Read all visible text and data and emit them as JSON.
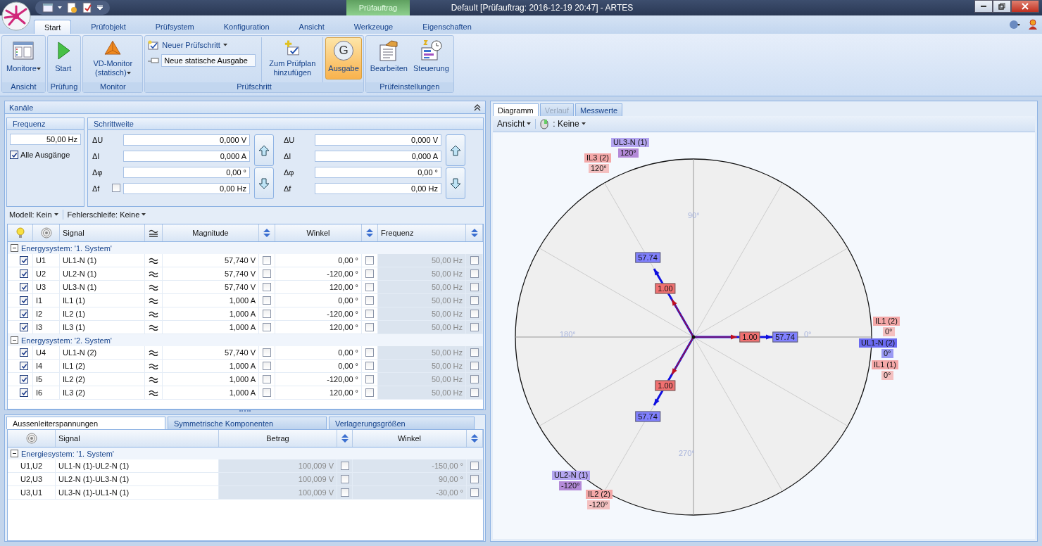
{
  "window": {
    "title": "Default [Prüfauftrag: 2016-12-19 20:47] - ARTES",
    "context_tab": "Prüfauftrag"
  },
  "ribbon_tabs": [
    {
      "label": "Start",
      "selected": true
    },
    {
      "label": "Prüfobjekt",
      "selected": false
    },
    {
      "label": "Prüfsystem",
      "selected": false
    },
    {
      "label": "Konfiguration",
      "selected": false
    },
    {
      "label": "Ansicht",
      "selected": false
    },
    {
      "label": "Werkzeuge",
      "selected": false
    },
    {
      "label": "Eigenschaften",
      "selected": false
    }
  ],
  "ribbon_groups": [
    {
      "title": "Ansicht",
      "kind": "buttons",
      "items": [
        {
          "label": "Monitore",
          "dropdown": true,
          "selected": false
        }
      ]
    },
    {
      "title": "Prüfung",
      "kind": "buttons",
      "items": [
        {
          "label": "Start",
          "dropdown": false,
          "selected": false
        }
      ]
    },
    {
      "title": "Monitor",
      "kind": "buttons",
      "items": [
        {
          "label": "VD-Monitor (statisch)",
          "dropdown": true,
          "selected": false
        }
      ]
    },
    {
      "title": "Prüfschritt",
      "kind": "step",
      "menu": "Neuer Prüfschritt",
      "field_value": "Neue statische Ausgabe",
      "items": [
        {
          "label": "Zum Prüfplan hinzufügen",
          "dropdown": false,
          "selected": false
        },
        {
          "label": "Ausgabe",
          "dropdown": false,
          "selected": true,
          "icon_text": "G"
        }
      ]
    },
    {
      "title": "Prüfeinstellungen",
      "kind": "buttons",
      "items": [
        {
          "label": "Bearbeiten",
          "dropdown": false,
          "selected": false
        },
        {
          "label": "Steuerung",
          "dropdown": false,
          "selected": false
        }
      ]
    }
  ],
  "channels": {
    "title": "Kanäle",
    "frequency": {
      "title": "Frequenz",
      "value": "50,00 Hz",
      "all_outputs": {
        "label": "Alle Ausgänge",
        "checked": true
      }
    },
    "step": {
      "title": "Schrittweite",
      "columns": [
        {
          "df_checked": false,
          "rows": [
            {
              "label": "ΔU",
              "value": "0,000 V"
            },
            {
              "label": "ΔI",
              "value": "0,000 A"
            },
            {
              "label": "Δφ",
              "value": "0,00 °"
            },
            {
              "label": "Δf",
              "value": "0,00 Hz"
            }
          ]
        },
        {
          "rows": [
            {
              "label": "ΔU",
              "value": "0,000 V"
            },
            {
              "label": "ΔI",
              "value": "0,000 A"
            },
            {
              "label": "Δφ",
              "value": "0,00 °"
            },
            {
              "label": "Δf",
              "value": "0,00 Hz"
            }
          ]
        }
      ]
    },
    "model": "Modell: Kein",
    "error_loop": "Fehlerschleife: Keine",
    "table": {
      "columns": [
        "Signal",
        "Magnitude",
        "Winkel",
        "Frequenz"
      ],
      "groups": [
        {
          "title": "Energysystem: '1. System'",
          "expanded": true,
          "rows": [
            {
              "checked": true,
              "id": "U1",
              "signal": "UL1-N (1)",
              "magnitude": "57,740 V",
              "angle": "0,00 °",
              "frequency": "50,00 Hz",
              "checks": [
                false,
                false,
                false
              ]
            },
            {
              "checked": true,
              "id": "U2",
              "signal": "UL2-N (1)",
              "magnitude": "57,740 V",
              "angle": "-120,00 °",
              "frequency": "50,00 Hz",
              "checks": [
                false,
                false,
                false
              ]
            },
            {
              "checked": true,
              "id": "U3",
              "signal": "UL3-N (1)",
              "magnitude": "57,740 V",
              "angle": "120,00 °",
              "frequency": "50,00 Hz",
              "checks": [
                false,
                false,
                false
              ]
            },
            {
              "checked": true,
              "id": "I1",
              "signal": "IL1 (1)",
              "magnitude": "1,000 A",
              "angle": "0,00 °",
              "frequency": "50,00 Hz",
              "checks": [
                false,
                false,
                false
              ]
            },
            {
              "checked": true,
              "id": "I2",
              "signal": "IL2 (1)",
              "magnitude": "1,000 A",
              "angle": "-120,00 °",
              "frequency": "50,00 Hz",
              "checks": [
                false,
                false,
                false
              ]
            },
            {
              "checked": true,
              "id": "I3",
              "signal": "IL3 (1)",
              "magnitude": "1,000 A",
              "angle": "120,00 °",
              "frequency": "50,00 Hz",
              "checks": [
                false,
                false,
                false
              ]
            }
          ]
        },
        {
          "title": "Energysystem: '2. System'",
          "expanded": true,
          "rows": [
            {
              "checked": true,
              "id": "U4",
              "signal": "UL1-N (2)",
              "magnitude": "57,740 V",
              "angle": "0,00 °",
              "frequency": "50,00 Hz",
              "checks": [
                false,
                false,
                false
              ]
            },
            {
              "checked": true,
              "id": "I4",
              "signal": "IL1 (2)",
              "magnitude": "1,000 A",
              "angle": "0,00 °",
              "frequency": "50,00 Hz",
              "checks": [
                false,
                false,
                false
              ]
            },
            {
              "checked": true,
              "id": "I5",
              "signal": "IL2 (2)",
              "magnitude": "1,000 A",
              "angle": "-120,00 °",
              "frequency": "50,00 Hz",
              "checks": [
                false,
                false,
                false
              ]
            },
            {
              "checked": true,
              "id": "I6",
              "signal": "IL3 (2)",
              "magnitude": "1,000 A",
              "angle": "120,00 °",
              "frequency": "50,00 Hz",
              "checks": [
                false,
                false,
                false
              ]
            }
          ]
        }
      ]
    }
  },
  "bottom_tabs": [
    {
      "label": "Aussenleiterspannungen",
      "selected": true
    },
    {
      "label": "Symmetrische Komponenten",
      "selected": false
    },
    {
      "label": "Verlagerungsgrößen",
      "selected": false
    }
  ],
  "line_table": {
    "columns": [
      "Signal",
      "Betrag",
      "Winkel"
    ],
    "groups": [
      {
        "title": "Energiesystem: '1. System'",
        "expanded": true,
        "rows": [
          {
            "id": "U1,U2",
            "signal": "UL1-N (1)-UL2-N (1)",
            "magnitude": "100,009 V",
            "angle": "-150,00 °",
            "checks": [
              false,
              false
            ]
          },
          {
            "id": "U2,U3",
            "signal": "UL2-N (1)-UL3-N (1)",
            "magnitude": "100,009 V",
            "angle": "90,00 °",
            "checks": [
              false,
              false
            ]
          },
          {
            "id": "U3,U1",
            "signal": "UL3-N (1)-UL1-N (1)",
            "magnitude": "100,009 V",
            "angle": "-30,00 °",
            "checks": [
              false,
              false
            ]
          }
        ]
      }
    ]
  },
  "diagram_tabs": [
    {
      "label": "Diagramm",
      "selected": true,
      "disabled": false
    },
    {
      "label": "Verlauf",
      "selected": false,
      "disabled": true
    },
    {
      "label": "Messwerte",
      "selected": false,
      "disabled": false
    }
  ],
  "diagram_toolbar": {
    "view": "Ansicht",
    "mouse_mode": ": Keine"
  },
  "diagram": {
    "angle_labels": [
      "90°",
      "180°",
      "270°",
      "0°"
    ],
    "phasors": [
      {
        "value": "57.74",
        "kind": "voltage",
        "color": "#8080ff"
      },
      {
        "value": "1.00",
        "kind": "current",
        "color": "#f07070"
      },
      {
        "value": "57.74",
        "kind": "voltage",
        "color": "#8080ff"
      },
      {
        "value": "1.00",
        "kind": "current",
        "color": "#f07070"
      },
      {
        "value": "57.74",
        "kind": "voltage",
        "color": "#8080ff"
      },
      {
        "value": "1.00",
        "kind": "current",
        "color": "#f07070"
      }
    ],
    "labels": [
      {
        "text": "UL3-N (1)",
        "color": "#b4a6f0"
      },
      {
        "text": "120°",
        "color": "#b48ad8"
      },
      {
        "text": "IL3 (2)",
        "color": "#f4a8a8"
      },
      {
        "text": "120°",
        "color": "#f4c0c0"
      },
      {
        "text": "IL1 (2)",
        "color": "#f4a8a8"
      },
      {
        "text": "0°",
        "color": "#f4c0c0"
      },
      {
        "text": "UL1-N (2)",
        "color": "#6a6af0"
      },
      {
        "text": "0°",
        "color": "#9a9af4"
      },
      {
        "text": "IL1 (1)",
        "color": "#f4a8a8"
      },
      {
        "text": "0°",
        "color": "#f4c0c0"
      },
      {
        "text": "UL2-N (1)",
        "color": "#b4a6f0"
      },
      {
        "text": "-120°",
        "color": "#b48ad8"
      },
      {
        "text": "IL2 (2)",
        "color": "#f4a8a8"
      },
      {
        "text": "-120°",
        "color": "#f4c0c0"
      }
    ]
  }
}
